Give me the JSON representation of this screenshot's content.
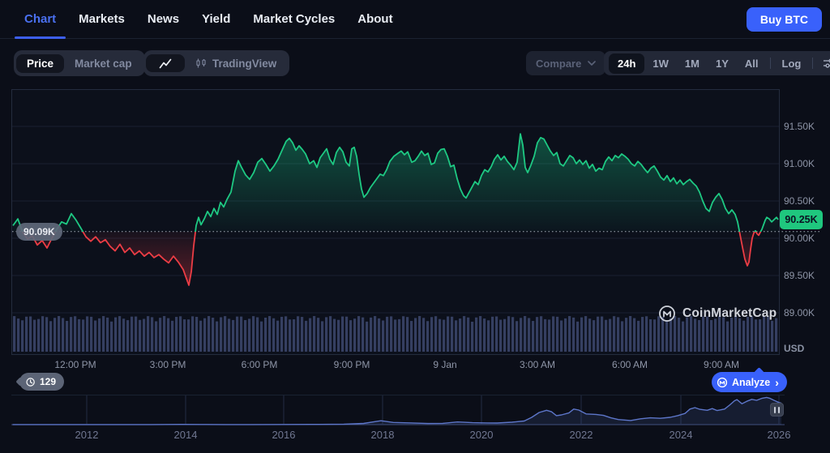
{
  "nav": {
    "tabs": [
      {
        "label": "Chart",
        "active": true
      },
      {
        "label": "Markets",
        "active": false
      },
      {
        "label": "News",
        "active": false
      },
      {
        "label": "Yield",
        "active": false
      },
      {
        "label": "Market Cycles",
        "active": false
      },
      {
        "label": "About",
        "active": false
      }
    ],
    "buy_button_label": "Buy BTC"
  },
  "toolbar": {
    "metric_toggle": {
      "active_label": "Price",
      "inactive_label": "Market cap"
    },
    "chart_style_toggle": {
      "tradingview_label": "TradingView"
    },
    "compare_label": "Compare",
    "range_buttons": [
      "24h",
      "1W",
      "1M",
      "1Y",
      "All"
    ],
    "active_range": "24h",
    "log_label": "Log"
  },
  "chart": {
    "open_price_label": "90.09K",
    "current_price_label": "90.25K",
    "y_ticks": [
      "91.50K",
      "91.00K",
      "90.50K",
      "90.00K",
      "89.50K",
      "89.00K"
    ],
    "unit_label": "USD",
    "x_ticks": [
      "12:00 PM",
      "3:00 PM",
      "6:00 PM",
      "9:00 PM",
      "9 Jan",
      "3:00 AM",
      "6:00 AM",
      "9:00 AM"
    ],
    "history_badge": "129",
    "analyze_label": "Analyze",
    "analyze_chevron": "›",
    "watermark_label": "CoinMarketCap"
  },
  "mini_chart": {
    "year_ticks": [
      "2012",
      "2014",
      "2016",
      "2018",
      "2020",
      "2022",
      "2024",
      "2026"
    ]
  },
  "colors": {
    "up": "#16c784",
    "down": "#ea3943",
    "accent": "#3961fb",
    "volume": "#3e4a72",
    "mini_line": "#5d76c9",
    "badge_green": "#1fc77e"
  },
  "chart_data": [
    {
      "type": "line",
      "title": "BTC/USD price, 24h",
      "ylabel": "USD (thousands)",
      "y_ticks_k": [
        91.5,
        91.0,
        90.5,
        90.0,
        89.5,
        89.0
      ],
      "x_ticks": [
        "12:00 PM",
        "3:00 PM",
        "6:00 PM",
        "9:00 PM",
        "9 Jan",
        "3:00 AM",
        "6:00 AM",
        "9:00 AM"
      ],
      "baseline_open_k": 90.09,
      "last_price_k": 90.25,
      "points": [
        [
          0,
          90.17
        ],
        [
          6,
          90.26
        ],
        [
          12,
          90.08
        ],
        [
          18,
          89.99
        ],
        [
          24,
          90.03
        ],
        [
          30,
          89.91
        ],
        [
          36,
          89.97
        ],
        [
          42,
          89.87
        ],
        [
          48,
          90.0
        ],
        [
          54,
          90.12
        ],
        [
          60,
          90.22
        ],
        [
          66,
          90.19
        ],
        [
          72,
          90.33
        ],
        [
          78,
          90.24
        ],
        [
          84,
          90.13
        ],
        [
          90,
          90.02
        ],
        [
          96,
          89.96
        ],
        [
          102,
          90.02
        ],
        [
          108,
          89.94
        ],
        [
          114,
          89.98
        ],
        [
          120,
          89.89
        ],
        [
          126,
          89.83
        ],
        [
          132,
          89.92
        ],
        [
          138,
          89.81
        ],
        [
          144,
          89.87
        ],
        [
          150,
          89.78
        ],
        [
          156,
          89.83
        ],
        [
          162,
          89.76
        ],
        [
          168,
          89.81
        ],
        [
          174,
          89.74
        ],
        [
          180,
          89.78
        ],
        [
          186,
          89.72
        ],
        [
          192,
          89.67
        ],
        [
          198,
          89.76
        ],
        [
          204,
          89.68
        ],
        [
          210,
          89.58
        ],
        [
          214,
          89.46
        ],
        [
          217,
          89.37
        ],
        [
          220,
          89.55
        ],
        [
          223,
          89.9
        ],
        [
          226,
          90.17
        ],
        [
          229,
          90.28
        ],
        [
          232,
          90.18
        ],
        [
          236,
          90.26
        ],
        [
          240,
          90.36
        ],
        [
          244,
          90.29
        ],
        [
          248,
          90.4
        ],
        [
          252,
          90.32
        ],
        [
          256,
          90.48
        ],
        [
          260,
          90.42
        ],
        [
          264,
          90.52
        ],
        [
          269,
          90.62
        ],
        [
          274,
          90.9
        ],
        [
          278,
          91.04
        ],
        [
          282,
          90.95
        ],
        [
          287,
          90.85
        ],
        [
          292,
          90.79
        ],
        [
          297,
          90.88
        ],
        [
          302,
          91.02
        ],
        [
          307,
          91.07
        ],
        [
          312,
          90.99
        ],
        [
          317,
          90.9
        ],
        [
          322,
          90.97
        ],
        [
          327,
          91.06
        ],
        [
          332,
          91.18
        ],
        [
          337,
          91.3
        ],
        [
          341,
          91.34
        ],
        [
          345,
          91.28
        ],
        [
          349,
          91.18
        ],
        [
          353,
          91.24
        ],
        [
          357,
          91.19
        ],
        [
          361,
          91.13
        ],
        [
          366,
          91.0
        ],
        [
          371,
          91.04
        ],
        [
          375,
          90.95
        ],
        [
          379,
          91.08
        ],
        [
          383,
          91.14
        ],
        [
          387,
          91.2
        ],
        [
          391,
          91.06
        ],
        [
          395,
          90.99
        ],
        [
          399,
          91.15
        ],
        [
          403,
          91.22
        ],
        [
          407,
          91.16
        ],
        [
          411,
          91.02
        ],
        [
          415,
          90.97
        ],
        [
          418,
          91.2
        ],
        [
          421,
          91.22
        ],
        [
          424,
          91.1
        ],
        [
          427,
          90.86
        ],
        [
          430,
          90.66
        ],
        [
          433,
          90.55
        ],
        [
          437,
          90.6
        ],
        [
          441,
          90.68
        ],
        [
          445,
          90.74
        ],
        [
          449,
          90.8
        ],
        [
          453,
          90.86
        ],
        [
          457,
          90.84
        ],
        [
          461,
          90.92
        ],
        [
          465,
          91.03
        ],
        [
          470,
          91.1
        ],
        [
          475,
          91.14
        ],
        [
          479,
          91.17
        ],
        [
          483,
          91.12
        ],
        [
          487,
          91.16
        ],
        [
          492,
          91.02
        ],
        [
          496,
          91.04
        ],
        [
          500,
          91.1
        ],
        [
          504,
          91.17
        ],
        [
          508,
          91.11
        ],
        [
          512,
          91.14
        ],
        [
          516,
          90.99
        ],
        [
          520,
          91.01
        ],
        [
          524,
          91.14
        ],
        [
          528,
          91.19
        ],
        [
          532,
          91.2
        ],
        [
          536,
          91.1
        ],
        [
          540,
          90.96
        ],
        [
          544,
          90.98
        ],
        [
          548,
          90.8
        ],
        [
          552,
          90.66
        ],
        [
          556,
          90.57
        ],
        [
          559,
          90.54
        ],
        [
          562,
          90.6
        ],
        [
          566,
          90.68
        ],
        [
          570,
          90.76
        ],
        [
          574,
          90.72
        ],
        [
          578,
          90.84
        ],
        [
          582,
          90.92
        ],
        [
          586,
          90.89
        ],
        [
          590,
          90.96
        ],
        [
          594,
          91.06
        ],
        [
          598,
          91.12
        ],
        [
          602,
          91.05
        ],
        [
          606,
          91.1
        ],
        [
          610,
          91.03
        ],
        [
          614,
          90.98
        ],
        [
          618,
          90.92
        ],
        [
          622,
          91.02
        ],
        [
          626,
          91.4
        ],
        [
          629,
          91.25
        ],
        [
          632,
          90.95
        ],
        [
          635,
          90.88
        ],
        [
          639,
          90.98
        ],
        [
          643,
          91.1
        ],
        [
          647,
          91.28
        ],
        [
          651,
          91.35
        ],
        [
          655,
          91.33
        ],
        [
          659,
          91.25
        ],
        [
          663,
          91.17
        ],
        [
          667,
          91.11
        ],
        [
          671,
          91.15
        ],
        [
          675,
          91.0
        ],
        [
          679,
          90.97
        ],
        [
          683,
          91.04
        ],
        [
          687,
          91.11
        ],
        [
          691,
          91.08
        ],
        [
          695,
          91.0
        ],
        [
          699,
          91.05
        ],
        [
          703,
          90.99
        ],
        [
          707,
          91.04
        ],
        [
          711,
          90.94
        ],
        [
          715,
          90.99
        ],
        [
          719,
          90.9
        ],
        [
          723,
          90.94
        ],
        [
          727,
          90.92
        ],
        [
          731,
          91.03
        ],
        [
          735,
          91.09
        ],
        [
          739,
          91.04
        ],
        [
          743,
          91.11
        ],
        [
          747,
          91.08
        ],
        [
          751,
          91.13
        ],
        [
          755,
          91.1
        ],
        [
          759,
          91.06
        ],
        [
          763,
          91.0
        ],
        [
          767,
          90.97
        ],
        [
          771,
          91.03
        ],
        [
          775,
          90.99
        ],
        [
          779,
          90.93
        ],
        [
          783,
          90.88
        ],
        [
          787,
          90.94
        ],
        [
          791,
          90.97
        ],
        [
          795,
          90.9
        ],
        [
          799,
          90.82
        ],
        [
          803,
          90.78
        ],
        [
          807,
          90.84
        ],
        [
          811,
          90.76
        ],
        [
          815,
          90.81
        ],
        [
          819,
          90.73
        ],
        [
          823,
          90.78
        ],
        [
          827,
          90.72
        ],
        [
          831,
          90.76
        ],
        [
          835,
          90.79
        ],
        [
          839,
          90.74
        ],
        [
          843,
          90.7
        ],
        [
          847,
          90.62
        ],
        [
          851,
          90.5
        ],
        [
          855,
          90.4
        ],
        [
          859,
          90.36
        ],
        [
          863,
          90.48
        ],
        [
          867,
          90.55
        ],
        [
          871,
          90.6
        ],
        [
          875,
          90.52
        ],
        [
          879,
          90.4
        ],
        [
          883,
          90.33
        ],
        [
          887,
          90.38
        ],
        [
          891,
          90.32
        ],
        [
          894,
          90.22
        ],
        [
          897,
          90.05
        ],
        [
          900,
          89.88
        ],
        [
          903,
          89.72
        ],
        [
          906,
          89.63
        ],
        [
          908,
          89.68
        ],
        [
          910,
          89.85
        ],
        [
          912,
          90.0
        ],
        [
          914,
          90.07
        ],
        [
          916,
          90.1
        ],
        [
          918,
          90.06
        ],
        [
          920,
          90.04
        ],
        [
          922,
          90.08
        ],
        [
          924,
          90.12
        ],
        [
          926,
          90.18
        ],
        [
          928,
          90.24
        ],
        [
          930,
          90.28
        ],
        [
          933,
          90.26
        ],
        [
          936,
          90.22
        ],
        [
          939,
          90.25
        ],
        [
          942,
          90.28
        ],
        [
          944,
          90.25
        ]
      ]
    },
    {
      "type": "line",
      "title": "BTC/USD price, all time (range selector)",
      "ylabel": "USD (thousands)",
      "x_ticks": [
        "2012",
        "2014",
        "2016",
        "2018",
        "2020",
        "2022",
        "2024",
        "2026"
      ],
      "points": [
        [
          2010.5,
          0.2
        ],
        [
          2011.5,
          0.2
        ],
        [
          2012,
          0.2
        ],
        [
          2012.8,
          0.3
        ],
        [
          2013.3,
          0.5
        ],
        [
          2013.9,
          1.1
        ],
        [
          2014.3,
          0.7
        ],
        [
          2014.8,
          0.4
        ],
        [
          2015.3,
          0.3
        ],
        [
          2016,
          0.7
        ],
        [
          2016.7,
          1.0
        ],
        [
          2017.2,
          2.0
        ],
        [
          2017.6,
          5.0
        ],
        [
          2017.95,
          16
        ],
        [
          2018.2,
          9
        ],
        [
          2018.5,
          7.5
        ],
        [
          2018.9,
          4.5
        ],
        [
          2019.2,
          5.5
        ],
        [
          2019.5,
          11
        ],
        [
          2019.8,
          8
        ],
        [
          2020.1,
          7
        ],
        [
          2020.3,
          6.5
        ],
        [
          2020.6,
          10
        ],
        [
          2020.85,
          15
        ],
        [
          2021.0,
          30
        ],
        [
          2021.15,
          50
        ],
        [
          2021.3,
          59
        ],
        [
          2021.4,
          53
        ],
        [
          2021.5,
          37
        ],
        [
          2021.6,
          40
        ],
        [
          2021.75,
          48
        ],
        [
          2021.85,
          64
        ],
        [
          2021.95,
          60
        ],
        [
          2022.1,
          44
        ],
        [
          2022.3,
          42
        ],
        [
          2022.45,
          38
        ],
        [
          2022.6,
          28
        ],
        [
          2022.75,
          21
        ],
        [
          2023.0,
          17
        ],
        [
          2023.2,
          24
        ],
        [
          2023.4,
          28
        ],
        [
          2023.6,
          26
        ],
        [
          2023.8,
          30
        ],
        [
          2023.95,
          37
        ],
        [
          2024.1,
          46
        ],
        [
          2024.2,
          64
        ],
        [
          2024.3,
          70
        ],
        [
          2024.4,
          63
        ],
        [
          2024.55,
          59
        ],
        [
          2024.65,
          66
        ],
        [
          2024.75,
          58
        ],
        [
          2024.9,
          64
        ],
        [
          2025.0,
          80
        ],
        [
          2025.1,
          98
        ],
        [
          2025.15,
          103
        ],
        [
          2025.25,
          86
        ],
        [
          2025.35,
          96
        ],
        [
          2025.45,
          104
        ],
        [
          2025.55,
          100
        ],
        [
          2025.65,
          108
        ],
        [
          2025.75,
          112
        ],
        [
          2025.82,
          108
        ],
        [
          2025.9,
          100
        ],
        [
          2026.0,
          91
        ],
        [
          2026.05,
          88
        ]
      ]
    }
  ]
}
